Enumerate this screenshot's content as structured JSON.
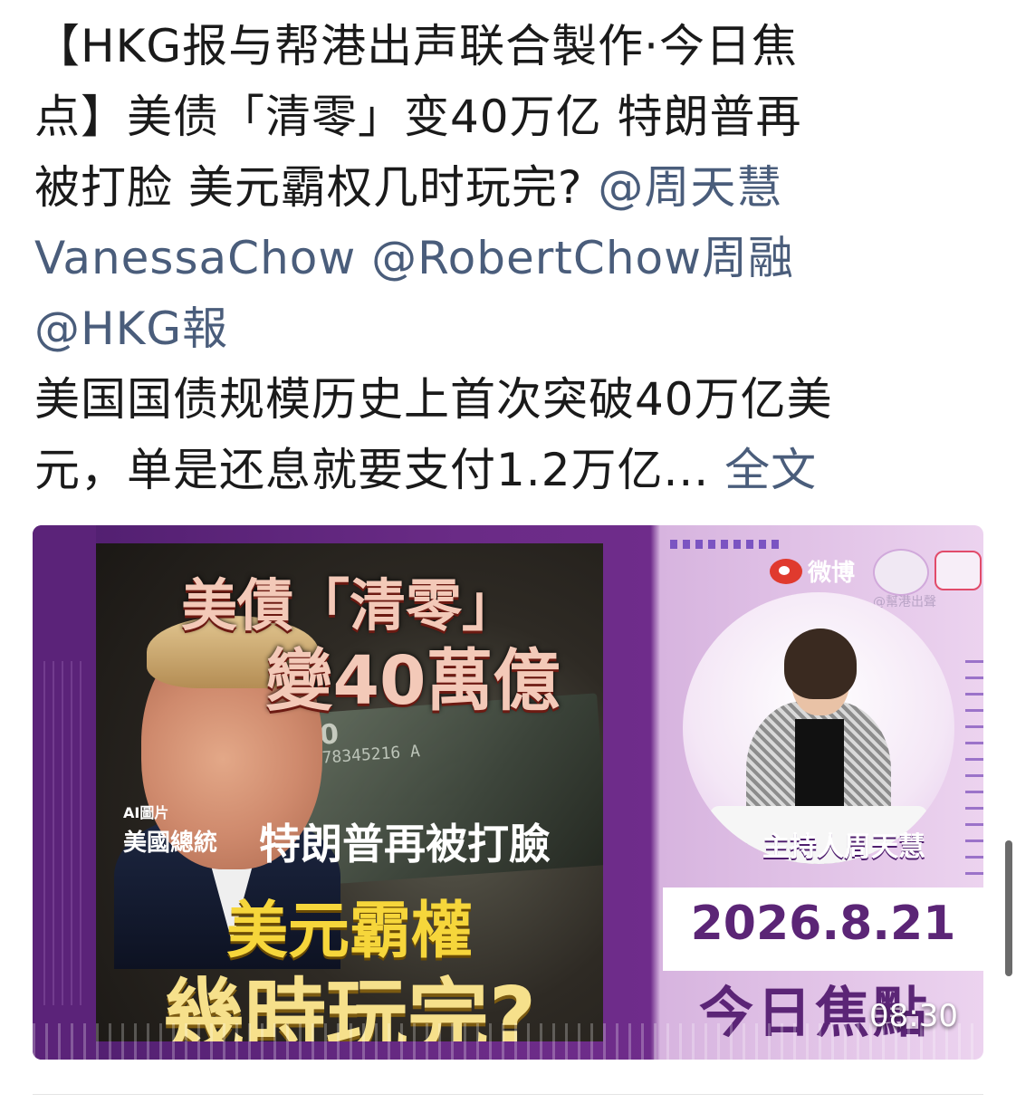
{
  "post": {
    "line1": "【HKG报与帮港出声联合製作·今日焦",
    "line2": "点】美债「清零」变40万亿 特朗普再",
    "line3_text": "被打脸 美元霸权几时玩完? ",
    "mention1": "@周天慧",
    "mention1_cont": "VanessaChow",
    "mention2": "@RobertChow周融",
    "mention3": "@HKG報",
    "body_line1": "美国国债规模历史上首次突破40万亿美",
    "body_line2": "元，单是还息就要支付1.2万亿... ",
    "full_text_link": "全文"
  },
  "video": {
    "poster_title1": "美債「清零」",
    "poster_title2": "變40萬億",
    "ai_tag": "AI圖片",
    "bill_big": "100",
    "bill_serial": "LB 78345216 A",
    "subtitle_small": "美國總統",
    "subtitle_big": "特朗普再被打臉",
    "headline1": "美元霸權",
    "headline2": "幾時玩完?",
    "weibo_label": "微博",
    "watermark_handle": "@幫港出聲",
    "host_label": "主持人周天慧",
    "date": "2026.8.21",
    "program": "今日焦點",
    "duration": "08:30"
  },
  "colors": {
    "link": "#4a5d7b",
    "brand_purple": "#5b2576",
    "headline_yellow": "#f6d63b"
  }
}
